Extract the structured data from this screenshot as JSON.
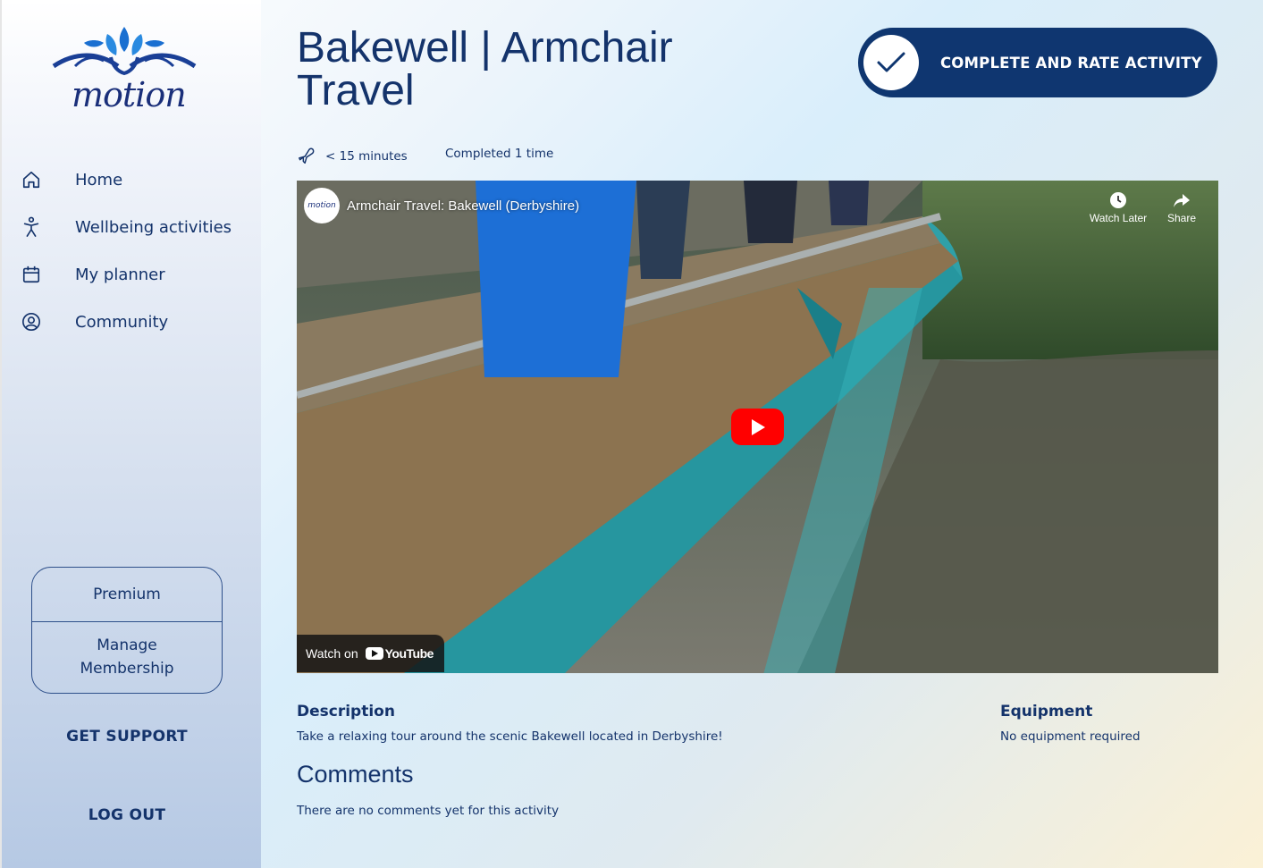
{
  "brand": {
    "logo_text": "motion"
  },
  "sidebar": {
    "items": [
      {
        "label": "Home",
        "icon": "home-icon"
      },
      {
        "label": "Wellbeing activities",
        "icon": "person-activity-icon"
      },
      {
        "label": "My planner",
        "icon": "calendar-icon"
      },
      {
        "label": "Community",
        "icon": "user-circle-icon"
      }
    ],
    "membership": {
      "premium_label": "Premium",
      "manage_label": "Manage Membership"
    },
    "support_label": "GET SUPPORT",
    "logout_label": "LOG OUT"
  },
  "activity": {
    "title": "Bakewell | Armchair Travel",
    "duration": "< 15 minutes",
    "completed": "Completed 1 time",
    "complete_button": "COMPLETE AND RATE ACTIVITY",
    "description_heading": "Description",
    "description": "Take a relaxing tour around the scenic Bakewell located in Derbyshire!",
    "equipment_heading": "Equipment",
    "equipment": "No equipment required",
    "comments_heading": "Comments",
    "comments_empty": "There are no comments yet for this activity"
  },
  "video": {
    "title": "Armchair Travel: Bakewell (Derbyshire)",
    "channel_avatar_text": "motion",
    "watch_later": "Watch Later",
    "share": "Share",
    "watch_on": "Watch on",
    "youtube_label": "YouTube"
  },
  "colors": {
    "primary": "#0f3670",
    "text": "#14336b",
    "youtube_red": "#ff0000"
  }
}
